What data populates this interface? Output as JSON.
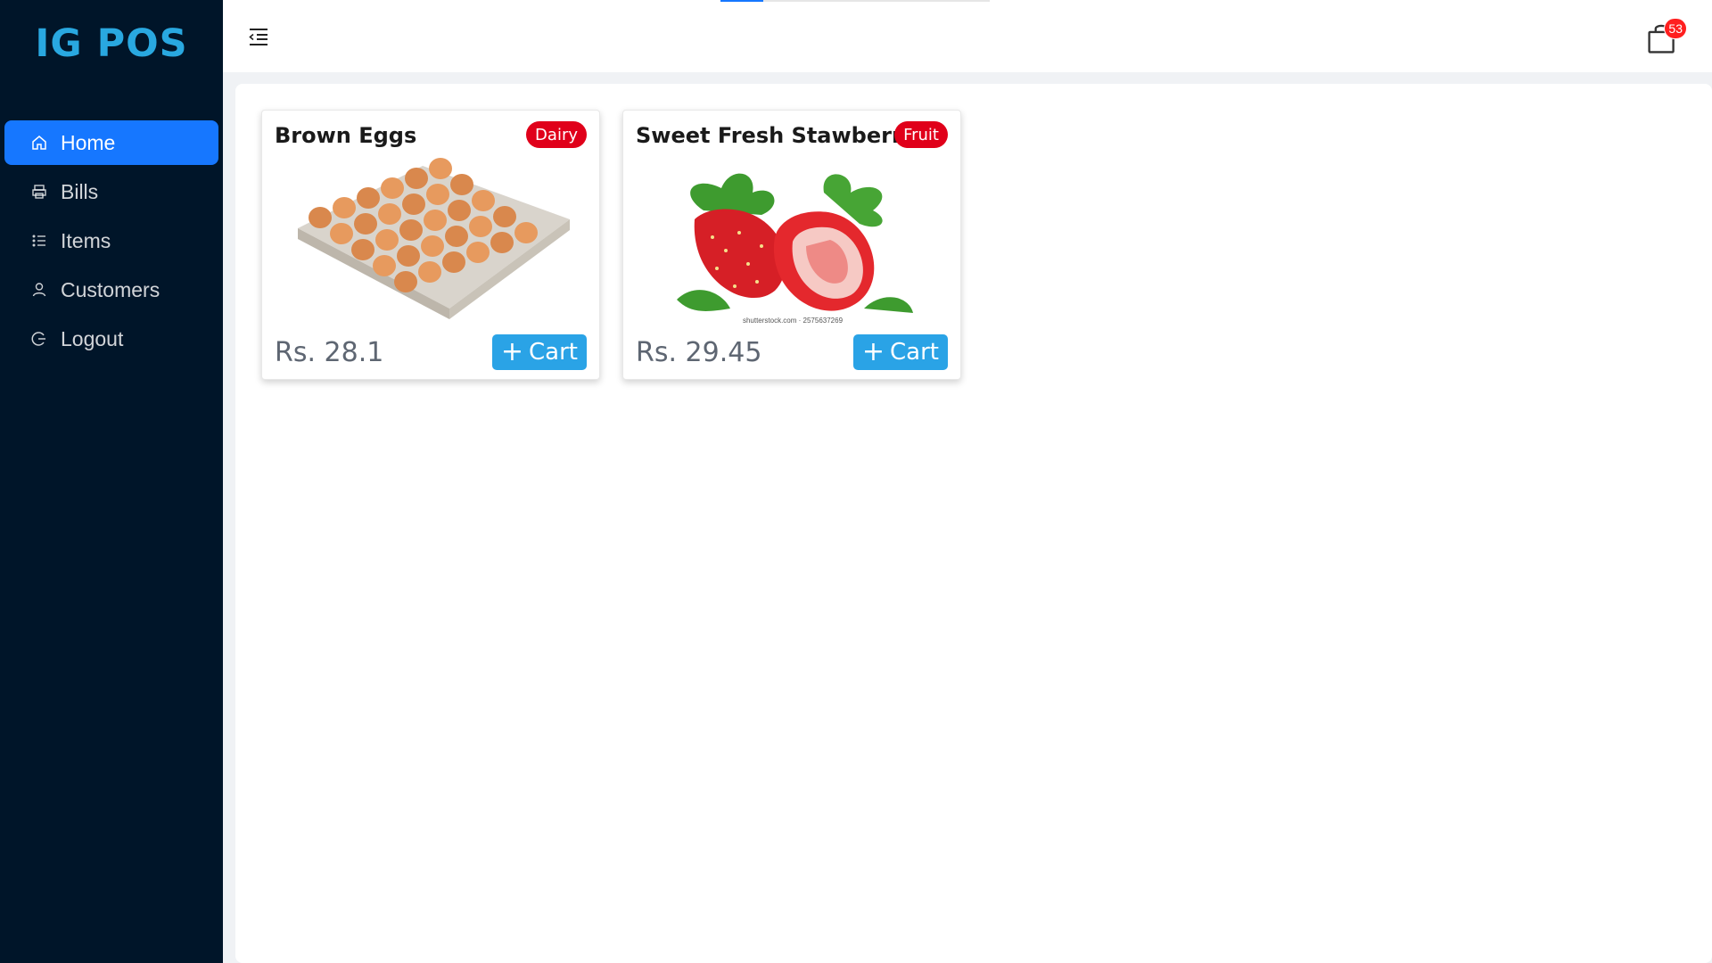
{
  "brand": {
    "title": "IG POS",
    "color": "#29a8e0"
  },
  "sidebar": {
    "items": [
      {
        "label": "Home",
        "icon": "home-icon",
        "active": true
      },
      {
        "label": "Bills",
        "icon": "printer-icon",
        "active": false
      },
      {
        "label": "Items",
        "icon": "list-icon",
        "active": false
      },
      {
        "label": "Customers",
        "icon": "user-icon",
        "active": false
      },
      {
        "label": "Logout",
        "icon": "logout-icon",
        "active": false
      }
    ]
  },
  "header": {
    "collapse_icon": "menu-fold-icon",
    "cart_icon": "shopping-bag-icon",
    "cart_count": "53",
    "loading_progress": 0.16
  },
  "products": [
    {
      "name": "Brown Eggs",
      "category": "Dairy",
      "price": "Rs. 28.1",
      "cart_label": "Cart",
      "image": "brown-eggs-tray"
    },
    {
      "name": "Sweet Fresh Stawberry",
      "category": "Fruit",
      "price": "Rs. 29.45",
      "cart_label": "Cart",
      "image": "strawberries",
      "watermark": "shutterstock.com · 2575637269"
    }
  ],
  "colors": {
    "sidebar_bg": "#001529",
    "active_item": "#1677ff",
    "tag_red": "#e0001a",
    "cart_button": "#2aa3e6"
  }
}
